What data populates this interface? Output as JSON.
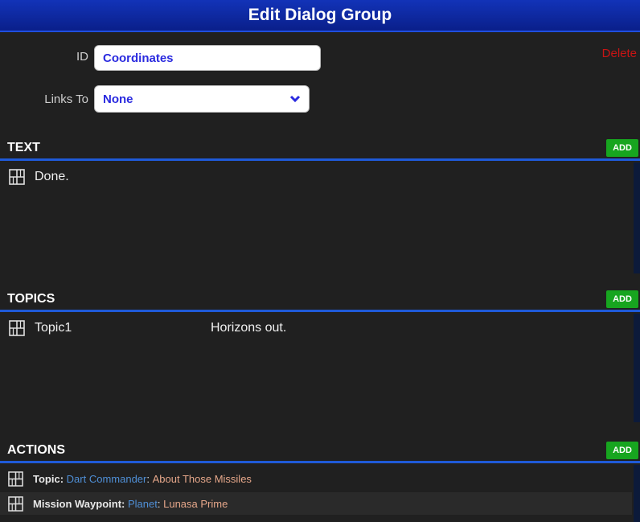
{
  "dialog": {
    "title": "Edit Dialog Group"
  },
  "form": {
    "id_label": "ID",
    "id_value": "Coordinates",
    "links_to_label": "Links To",
    "links_to_value": "None",
    "delete_label": "Delete"
  },
  "sections": {
    "text": {
      "title": "TEXT",
      "add_label": "ADD",
      "items": [
        {
          "text": "Done."
        }
      ]
    },
    "topics": {
      "title": "TOPICS",
      "add_label": "ADD",
      "items": [
        {
          "name": "Topic1",
          "text": "Horizons out."
        }
      ]
    },
    "actions": {
      "title": "ACTIONS",
      "add_label": "ADD",
      "items": [
        {
          "type": "Topic:",
          "target": "Dart Commander",
          "sep": ":",
          "value": "About Those Missiles"
        },
        {
          "type": "Mission Waypoint:",
          "target": "Planet",
          "sep": ":",
          "value": "Lunasa Prime"
        }
      ]
    }
  },
  "colors": {
    "title_bar": "#0a1f8a",
    "accent_line": "#1f5ad8",
    "add_button": "#17a51f",
    "delete": "#c81414",
    "link_blue": "#4f8fd6",
    "link_orange": "#e6a78a"
  },
  "icons": {
    "drag_handle": "grid-icon",
    "dropdown": "chevron-down-icon"
  }
}
